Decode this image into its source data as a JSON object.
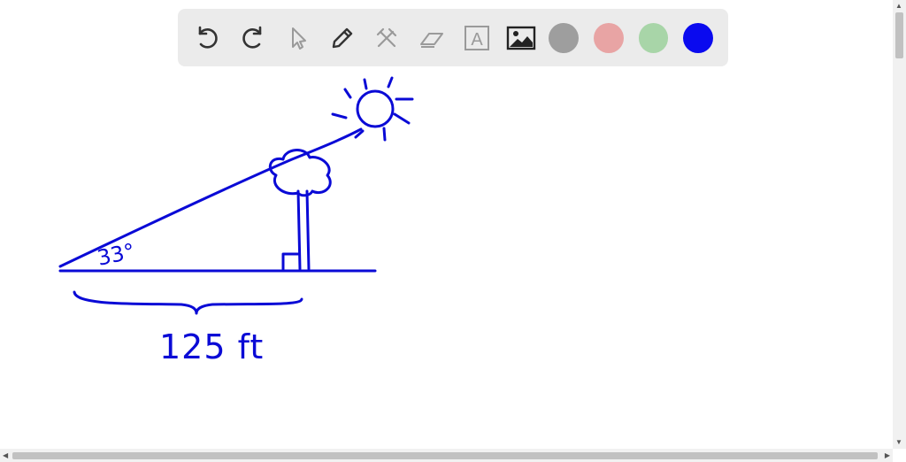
{
  "toolbar": {
    "tools": [
      {
        "icon": "undo-icon"
      },
      {
        "icon": "redo-icon"
      },
      {
        "icon": "pointer-icon"
      },
      {
        "icon": "pencil-icon"
      },
      {
        "icon": "tools-icon"
      },
      {
        "icon": "eraser-icon"
      },
      {
        "icon": "text-icon",
        "label": "A"
      },
      {
        "icon": "image-icon"
      }
    ],
    "colors": [
      "#9e9e9e",
      "#e8a4a4",
      "#a8d5a8",
      "#0a0aef"
    ],
    "selected_color": "#0a0aef"
  },
  "drawing": {
    "angle_label": "33°",
    "distance_label": "125 ft",
    "stroke_color": "#0a0ad6"
  }
}
